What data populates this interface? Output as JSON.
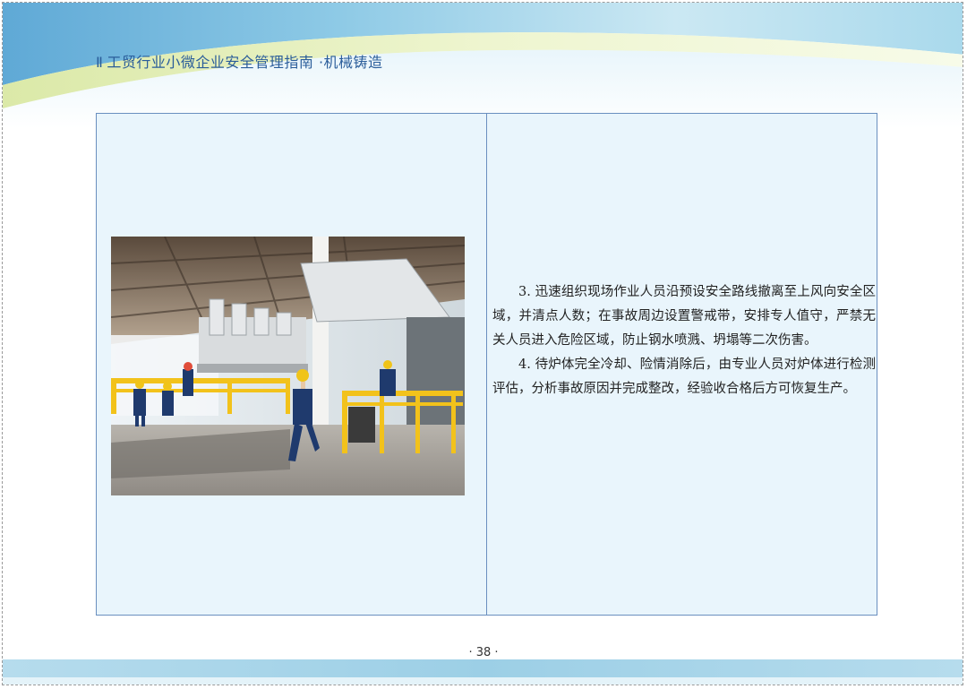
{
  "header": {
    "bar_glyph": "Ⅱ",
    "title": "工贸行业小微企业安全管理指南 ·机械铸造"
  },
  "photo": {
    "icon": "factory-workers-photo"
  },
  "body": {
    "paragraphs": [
      "3. 迅速组织现场作业人员沿预设安全路线撤离至上风向安全区域，并清点人数；在事故周边设置警戒带，安排专人值守，严禁无关人员进入危险区域，防止钢水喷溅、坍塌等二次伤害。",
      "4. 待炉体完全冷却、险情消除后，由专业人员对炉体进行检测评估，分析事故原因并完成整改，经验收合格后方可恢复生产。"
    ]
  },
  "footer": {
    "page_number": "· 38 ·"
  },
  "colors": {
    "accent": "#2a5d9a",
    "panel": "#e9f5fc",
    "border": "#6a8fbf"
  }
}
